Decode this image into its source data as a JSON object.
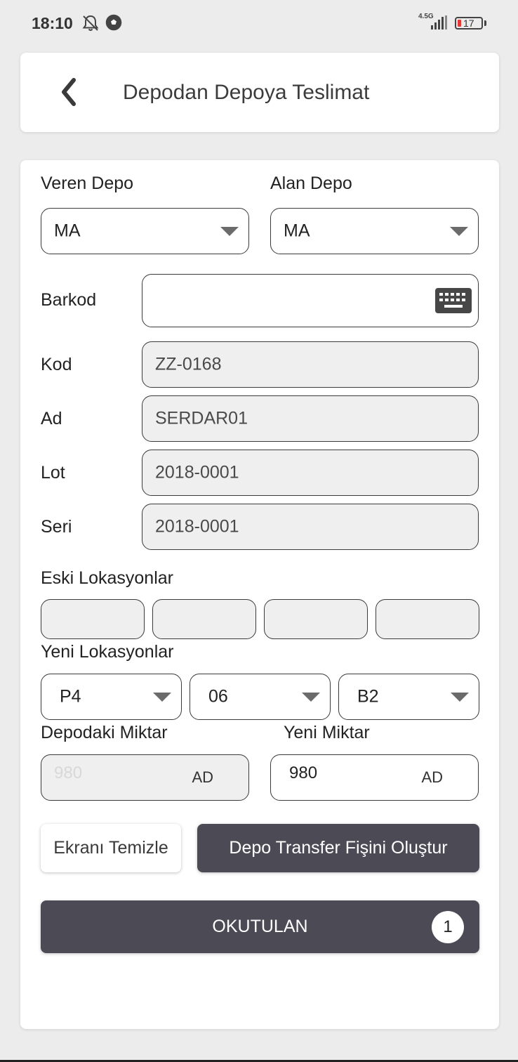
{
  "status_bar": {
    "time": "18:10",
    "network": "4.5G",
    "battery": "17",
    "icons": [
      "bell-off-icon",
      "football-icon",
      "signal-icon",
      "battery-icon"
    ]
  },
  "header": {
    "back_icon": "chevron-left-icon",
    "title": "Depodan Depoya Teslimat"
  },
  "warehouses": {
    "source_label": "Veren Depo",
    "source_value": "MA",
    "target_label": "Alan Depo",
    "target_value": "MA"
  },
  "barcode": {
    "label": "Barkod",
    "value": "",
    "icon": "keyboard-icon"
  },
  "fields": {
    "kod_label": "Kod",
    "kod_value": "ZZ-0168",
    "ad_label": "Ad",
    "ad_value": "SERDAR01",
    "lot_label": "Lot",
    "lot_value": "2018-0001",
    "seri_label": "Seri",
    "seri_value": "2018-0001"
  },
  "old_locations": {
    "label": "Eski Lokasyonlar",
    "values": [
      "",
      "",
      "",
      ""
    ]
  },
  "new_locations": {
    "label": "Yeni Lokasyonlar",
    "values": [
      "P4",
      "06",
      "B2"
    ]
  },
  "quantities": {
    "stock_label": "Depodaki Miktar",
    "stock_value": "980",
    "stock_unit": "AD",
    "new_label": "Yeni Miktar",
    "new_value": "980",
    "new_unit": "AD"
  },
  "actions": {
    "clear_label": "Ekranı Temizle",
    "create_label": "Depo Transfer Fişini Oluştur",
    "scanned_label": "OKUTULAN",
    "scanned_count": "1"
  },
  "colors": {
    "dark_button": "#4c4a55",
    "readonly_field": "#efefef",
    "battery_low": "#e53935"
  }
}
